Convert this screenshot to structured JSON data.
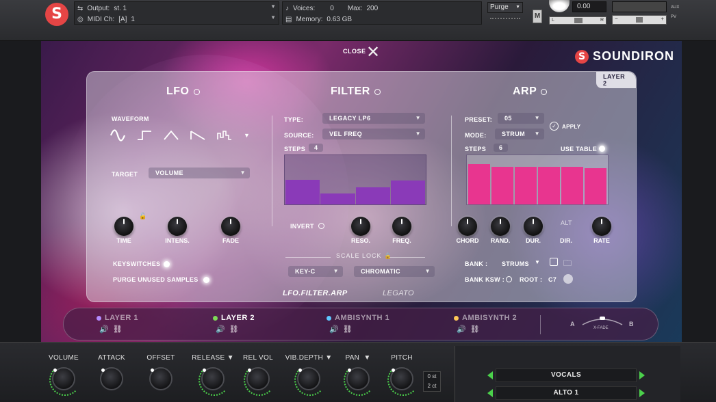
{
  "header": {
    "output_label": "Output:",
    "output_value": "st. 1",
    "midi_label": "MIDI Ch:",
    "midi_port": "[A]",
    "midi_value": "1",
    "voices_label": "Voices:",
    "voices_value": "0",
    "max_label": "Max:",
    "max_value": "200",
    "memory_label": "Memory:",
    "memory_value": "0.63 GB",
    "purge_label": "Purge",
    "m_label": "M",
    "tune_value": "0.00",
    "pan_left": "L",
    "pan_right": "R",
    "vol_minus": "−",
    "vol_plus": "+",
    "aux_label": "AUX",
    "pv_label": "PV"
  },
  "brand": {
    "name": "SOUNDIRON"
  },
  "close_label": "CLOSE",
  "layer_tag": "LAYER 2",
  "lfo": {
    "title": "LFO",
    "waveform_label": "WAVEFORM",
    "target_label": "TARGET",
    "target_value": "VOLUME",
    "knobs": [
      "TIME",
      "INTENS.",
      "FADE"
    ],
    "keyswitches_label": "KEYSWITCHES",
    "purge_label": "PURGE UNUSED SAMPLES"
  },
  "filter": {
    "title": "FILTER",
    "type_label": "TYPE:",
    "type_value": "LEGACY LP6",
    "source_label": "SOURCE:",
    "source_value": "VEL FREQ",
    "steps_label": "STEPS",
    "steps_value": "4",
    "steps": [
      0.5,
      0.22,
      0.35,
      0.48
    ],
    "invert_label": "INVERT",
    "knobs": [
      "RESO.",
      "FREQ."
    ],
    "scale_lock_label": "SCALE LOCK",
    "key_value": "KEY-C",
    "scale_value": "CHROMATIC"
  },
  "arp": {
    "title": "ARP",
    "preset_label": "PRESET:",
    "preset_value": "05",
    "apply_label": "APPLY",
    "mode_label": "MODE:",
    "mode_value": "STRUM",
    "steps_label": "STEPS",
    "steps_value": "6",
    "use_table_label": "USE TABLE",
    "steps": [
      0.82,
      0.76,
      0.77,
      0.77,
      0.77,
      0.74
    ],
    "knobs": [
      "CHORD",
      "RAND.",
      "DUR.",
      "DIR.",
      "RATE"
    ],
    "alt_label": "ALT",
    "bank_label": "BANK :",
    "bank_value": "STRUMS",
    "bank_ksw_label": "BANK KSW :",
    "root_label": "ROOT :",
    "root_value": "C7"
  },
  "tabs": {
    "active": "LFO.FILTER.ARP",
    "other": "LEGATO"
  },
  "layers": [
    {
      "name": "LAYER 1",
      "color": "#b48cff"
    },
    {
      "name": "LAYER 2",
      "color": "#7ed957"
    },
    {
      "name": "AMBISYNTH 1",
      "color": "#5ec8ff"
    },
    {
      "name": "AMBISYNTH 2",
      "color": "#ffc857"
    }
  ],
  "xfade": {
    "left": "A",
    "right": "B",
    "label": "X-FADE"
  },
  "bottom_knobs": [
    "VOLUME",
    "ATTACK",
    "OFFSET",
    "RELEASE",
    "REL VOL",
    "VIB.DEPTH",
    "PAN",
    "PITCH"
  ],
  "pitch_readout": {
    "line1": "0 st",
    "line2": "2 ct"
  },
  "vocals": {
    "row1": "VOCALS",
    "row2": "ALTO 1"
  },
  "colors": {
    "accent_pink": "#e8358f",
    "filter_purple": "#8a3ab8",
    "green": "#4bd14b",
    "brand_red": "#e54545"
  }
}
